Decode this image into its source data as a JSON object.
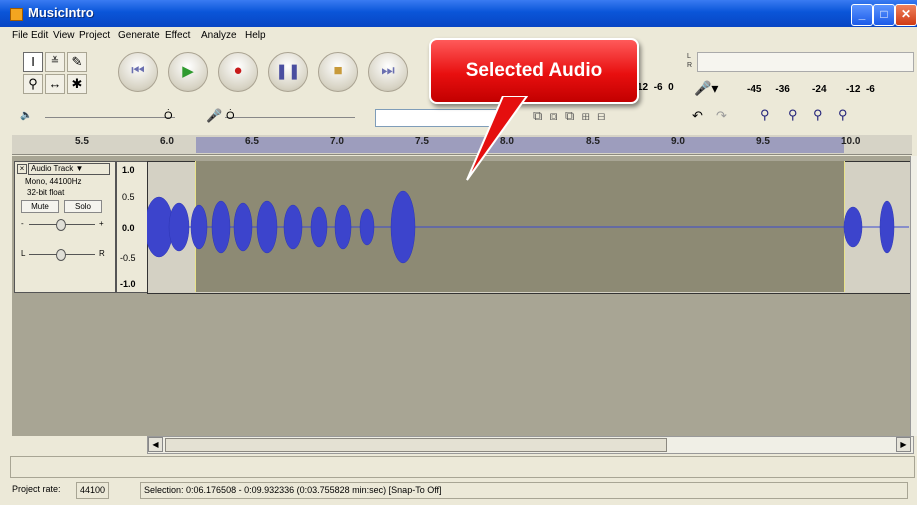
{
  "window": {
    "title": "MusicIntro"
  },
  "menu": [
    "File",
    "Edit",
    "View",
    "Project",
    "Generate",
    "Effect",
    "Analyze",
    "Help"
  ],
  "meter": {
    "lr": [
      "L",
      "R"
    ],
    "scale_top": [
      "12",
      "-6",
      "0"
    ],
    "scale_right": [
      "-45",
      "-36",
      "-24",
      "-12",
      "-6"
    ]
  },
  "ruler_ticks": [
    "5.5",
    "6.0",
    "6.5",
    "7.0",
    "7.5",
    "8.0",
    "8.5",
    "9.0",
    "9.5",
    "10.0"
  ],
  "track": {
    "name": "Audio Track",
    "format": "Mono, 44100Hz",
    "bits": "32-bit float",
    "mute": "Mute",
    "solo": "Solo",
    "gain_minus": "-",
    "gain_plus": "+",
    "pan_left": "L",
    "pan_right": "R"
  },
  "amplitude": [
    "1.0",
    "0.5",
    "0.0",
    "-0.5",
    "-1.0"
  ],
  "callout": {
    "label": "Selected Audio"
  },
  "status": {
    "project_rate_label": "Project rate:",
    "project_rate_value": "44100",
    "selection": "Selection: 0:06.176508 - 0:09.932336 (0:03.755828 min:sec)  [Snap-To Off]"
  }
}
